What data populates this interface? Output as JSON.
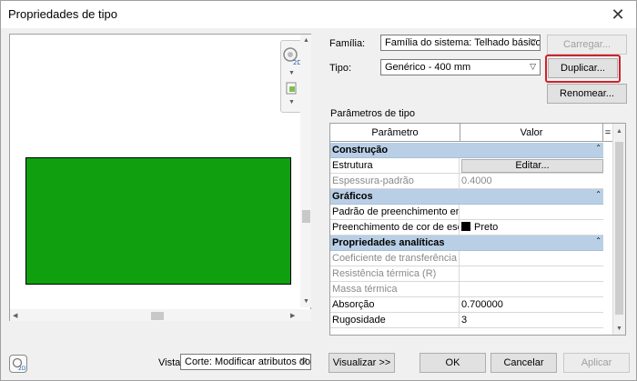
{
  "window": {
    "title": "Propriedades de tipo"
  },
  "top": {
    "familia_label": "Família:",
    "familia_value": "Família do sistema: Telhado básico",
    "tipo_label": "Tipo:",
    "tipo_value": "Genérico - 400 mm",
    "carregar": "Carregar...",
    "duplicar": "Duplicar...",
    "renomear": "Renomear..."
  },
  "params": {
    "group_label": "Parâmetros de tipo",
    "col_param": "Parâmetro",
    "col_value": "Valor",
    "col_eq": "=",
    "sections": [
      {
        "name": "Construção"
      },
      {
        "name": "Gráficos"
      },
      {
        "name": "Propriedades analíticas"
      }
    ],
    "rows": [
      {
        "param": "Estrutura",
        "value": "Editar..."
      },
      {
        "param": "Espessura-padrão",
        "value": "0.4000"
      },
      {
        "param": "Padrão de preenchimento em",
        "value": ""
      },
      {
        "param": "Preenchimento de cor de esca",
        "value": "Preto"
      },
      {
        "param": "Coeficiente de transferência d",
        "value": ""
      },
      {
        "param": "Resistência térmica (R)",
        "value": ""
      },
      {
        "param": "Massa térmica",
        "value": ""
      },
      {
        "param": "Absorção",
        "value": "0.700000"
      },
      {
        "param": "Rugosidade",
        "value": "3"
      }
    ]
  },
  "bottom": {
    "vista_label": "Vista:",
    "vista_value": "Corte: Modificar atributos do ti",
    "visualizar": "Visualizar >>",
    "ok": "OK",
    "cancelar": "Cancelar",
    "aplicar": "Aplicar"
  },
  "colors": {
    "preview_fill": "#0f9f0f",
    "section_bg": "#b9cfe6",
    "highlight": "#d1212b"
  },
  "icons": {
    "close": "close-icon",
    "nav": "navigation-wheel-icon",
    "preview_toggle": "preview-icon"
  }
}
